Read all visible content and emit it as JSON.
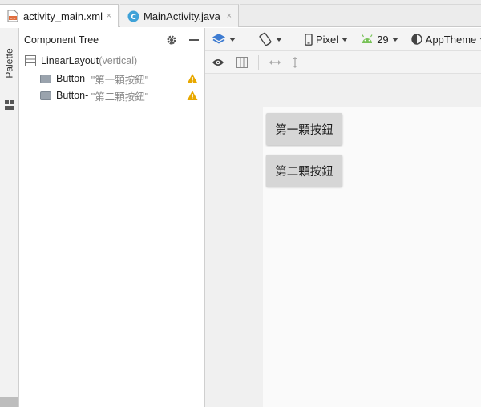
{
  "tabs": [
    {
      "label": "activity_main.xml",
      "icon": "xml-file-icon",
      "close": "×",
      "active": true
    },
    {
      "label": "MainActivity.java",
      "icon": "java-class-icon",
      "close": "×",
      "active": false
    }
  ],
  "left_strip": {
    "palette_label": "Palette"
  },
  "tree": {
    "title": "Component Tree",
    "root": {
      "name": "LinearLayout",
      "detail": "(vertical)"
    },
    "children": [
      {
        "prefix": "Button",
        "sep": "- ",
        "text": "\"第一顆按鈕\""
      },
      {
        "prefix": "Button",
        "sep": "- ",
        "text": "\"第二顆按鈕\""
      }
    ]
  },
  "toolbar": {
    "device": "Pixel",
    "api": "29",
    "theme": "AppTheme"
  },
  "canvas": {
    "buttons": [
      "第一顆按鈕",
      "第二顆按鈕"
    ]
  },
  "colors": {
    "android_green": "#78c257",
    "layers_blue": "#3d7bd1",
    "warning_yellow": "#e8a800",
    "java_class_blue": "#3fa2d8"
  }
}
